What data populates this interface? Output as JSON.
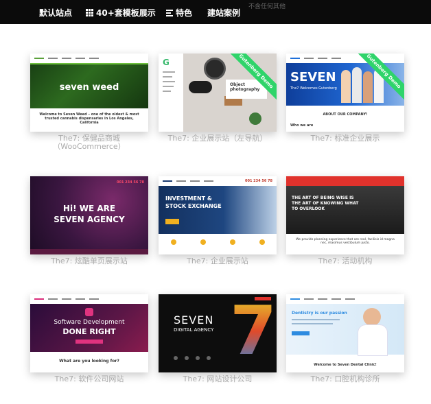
{
  "nav": {
    "default_site": "默认站点",
    "templates": "40+套模板展示",
    "features": "特色",
    "cases": "建站案例",
    "ghost_text": "不含任何其他"
  },
  "cards": [
    {
      "caption_line1": "The7: 保健品商城",
      "caption_line2": "（WooCommerce）",
      "hero": "seven weed",
      "sub": "Welcome to Seven Weed – one of the oldest & most trusted cannabis dispensaries in Los Angeles, California"
    },
    {
      "caption_line1": "The7: 企业展示站（左导航）",
      "caption_line2": "",
      "ribbon": "Gutenberg Demo",
      "overlay": "Object photography",
      "logo": "G"
    },
    {
      "caption_line1": "The7: 标准企业展示",
      "caption_line2": "",
      "ribbon": "Gutenberg Demo",
      "hero": "SEVEN",
      "sub": "The7 Welcomes Gutenberg",
      "section": "ABOUT OUR COMPANY!",
      "who": "Who we are"
    },
    {
      "caption_line1": "The7: 炫酷单页展示站",
      "caption_line2": "",
      "hero1": "Hi! WE ARE",
      "hero2": "SEVEN AGENCY",
      "phone": "001 234 56 78"
    },
    {
      "caption_line1": "The7: 企业展示站",
      "caption_line2": "",
      "hero1": "INVESTMENT &",
      "hero2": "STOCK EXCHANGE",
      "phone": "001 234 56 78"
    },
    {
      "caption_line1": "The7: 活动机构",
      "caption_line2": "",
      "hero1": "THE ART OF BEING WISE IS",
      "hero2": "THE ART OF KNOWING WHAT",
      "hero3": "TO OVERLOOK",
      "sub": "We provide planning experience that are real, facilisis id magna nec, maximus vestibulum justo."
    },
    {
      "caption_line1": "The7: 软件公司网站",
      "caption_line2": "",
      "hero1": "Software Development",
      "hero2": "DONE RIGHT",
      "section": "What are you looking for?"
    },
    {
      "caption_line1": "The7: 网站设计公司",
      "caption_line2": "",
      "hero1": "SEVEN",
      "hero2": "DIGITAL AGENCY",
      "big": "7"
    },
    {
      "caption_line1": "The7: 口腔机构诊所",
      "caption_line2": "",
      "hero": "Dentistry is our passion",
      "section": "Welcome to Seven Dental Clinic!"
    }
  ]
}
